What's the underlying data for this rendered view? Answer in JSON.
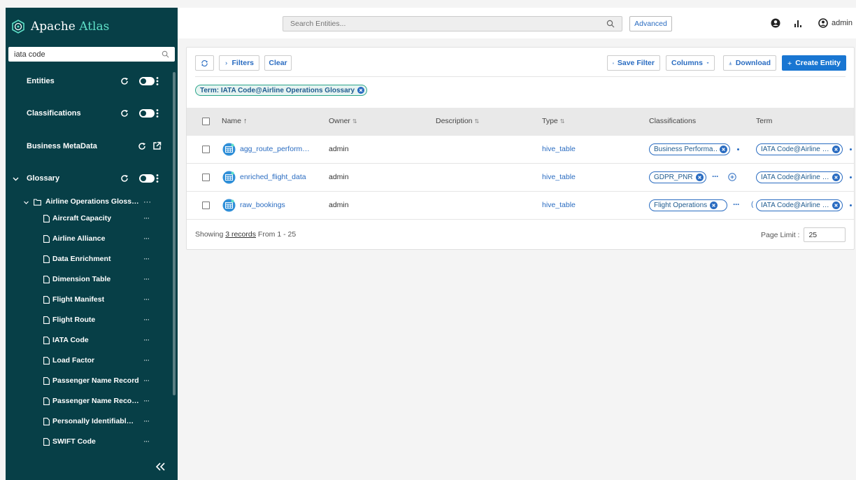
{
  "brand": {
    "name_prefix": "Apache",
    "name_suffix": "Atlas"
  },
  "sidebar": {
    "search_value": "iata code",
    "sections": {
      "entities": "Entities",
      "classifications": "Classifications",
      "business_metadata": "Business MetaData",
      "glossary": "Glossary"
    },
    "glossary_root": "Airline Operations Gloss…",
    "terms": [
      "Aircraft Capacity",
      "Airline Alliance",
      "Data Enrichment",
      "Dimension Table",
      "Flight Manifest",
      "Flight Route",
      "IATA Code",
      "Load Factor",
      "Passenger Name Record",
      "Passenger Name Reco…",
      "Personally Identifiabl…",
      "SWIFT Code"
    ],
    "dots": "···",
    "collapse_glyph": "«"
  },
  "topbar": {
    "search_placeholder": "Search Entities...",
    "advanced_label": "Advanced",
    "user_label": "admin"
  },
  "toolbar": {
    "filters_label": "Filters",
    "clear_label": "Clear",
    "save_filter_label": "Save Filter",
    "columns_label": "Columns",
    "download_label": "Download",
    "create_entity_label": "Create Entity"
  },
  "active_filter": "Term: IATA Code@Airline Operations Glossary",
  "table": {
    "headers": {
      "name": "Name",
      "owner": "Owner",
      "description": "Description",
      "type": "Type",
      "classifications": "Classifications",
      "term": "Term"
    },
    "sort_up": "↑",
    "sort_both": "⇅",
    "rows": [
      {
        "name": "agg_route_perform…",
        "owner": "admin",
        "description": "",
        "type": "hive_table",
        "classification": "Business Performa…",
        "term": "IATA Code@Airline …"
      },
      {
        "name": "enriched_flight_data",
        "owner": "admin",
        "description": "",
        "type": "hive_table",
        "classification": "GDPR_PNR",
        "term": "IATA Code@Airline …"
      },
      {
        "name": "raw_bookings",
        "owner": "admin",
        "description": "",
        "type": "hive_table",
        "classification": "Flight Operations",
        "term": "IATA Code@Airline …"
      }
    ],
    "more_glyph": "···",
    "paren_glyph": "(",
    "footer_prefix": "Showing",
    "footer_link": "3 records",
    "footer_suffix": "From 1 - 25",
    "page_limit_label": "Page Limit :",
    "page_limit_value": "25"
  },
  "colors": {
    "sidebar_bg": "#073f47",
    "brand_accent": "#5fe0c8",
    "link": "#2a6cc1",
    "primary": "#1976d2",
    "term_chip_border": "#2aa58a"
  }
}
